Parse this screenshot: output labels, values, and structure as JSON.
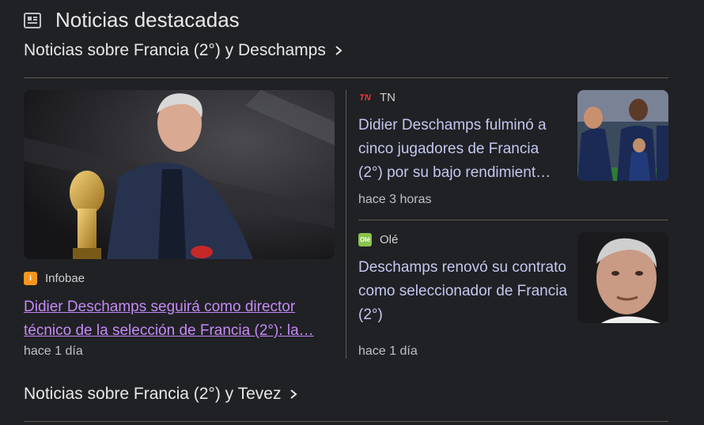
{
  "header": {
    "title": "Noticias destacadas",
    "icon": "news-icon"
  },
  "topics": [
    {
      "label": "Noticias sobre Francia (2°) y Deschamps"
    },
    {
      "label": "Noticias sobre Francia (2°) y Tevez"
    }
  ],
  "main_story": {
    "source": "Infobae",
    "headline": "Didier Deschamps seguirá como director técnico de la selección de Francia (2°): la…",
    "time": "hace 1 día",
    "favicon_color": "#f7941d"
  },
  "side_stories": [
    {
      "source": "TN",
      "headline": "Didier Deschamps fulminó a cinco jugadores de Francia (2°) por su bajo rendimient…",
      "time": "hace 3 horas",
      "favicon_color": "#1a1a6e"
    },
    {
      "source": "Olé",
      "headline": "Deschamps renovó su contrato como seleccionador de Francia (2°)",
      "time": "hace 1 día",
      "favicon_color": "#8bc34a"
    }
  ],
  "colors": {
    "background": "#202124",
    "link": "#c3c8f0",
    "visited_link": "#c58af9"
  }
}
